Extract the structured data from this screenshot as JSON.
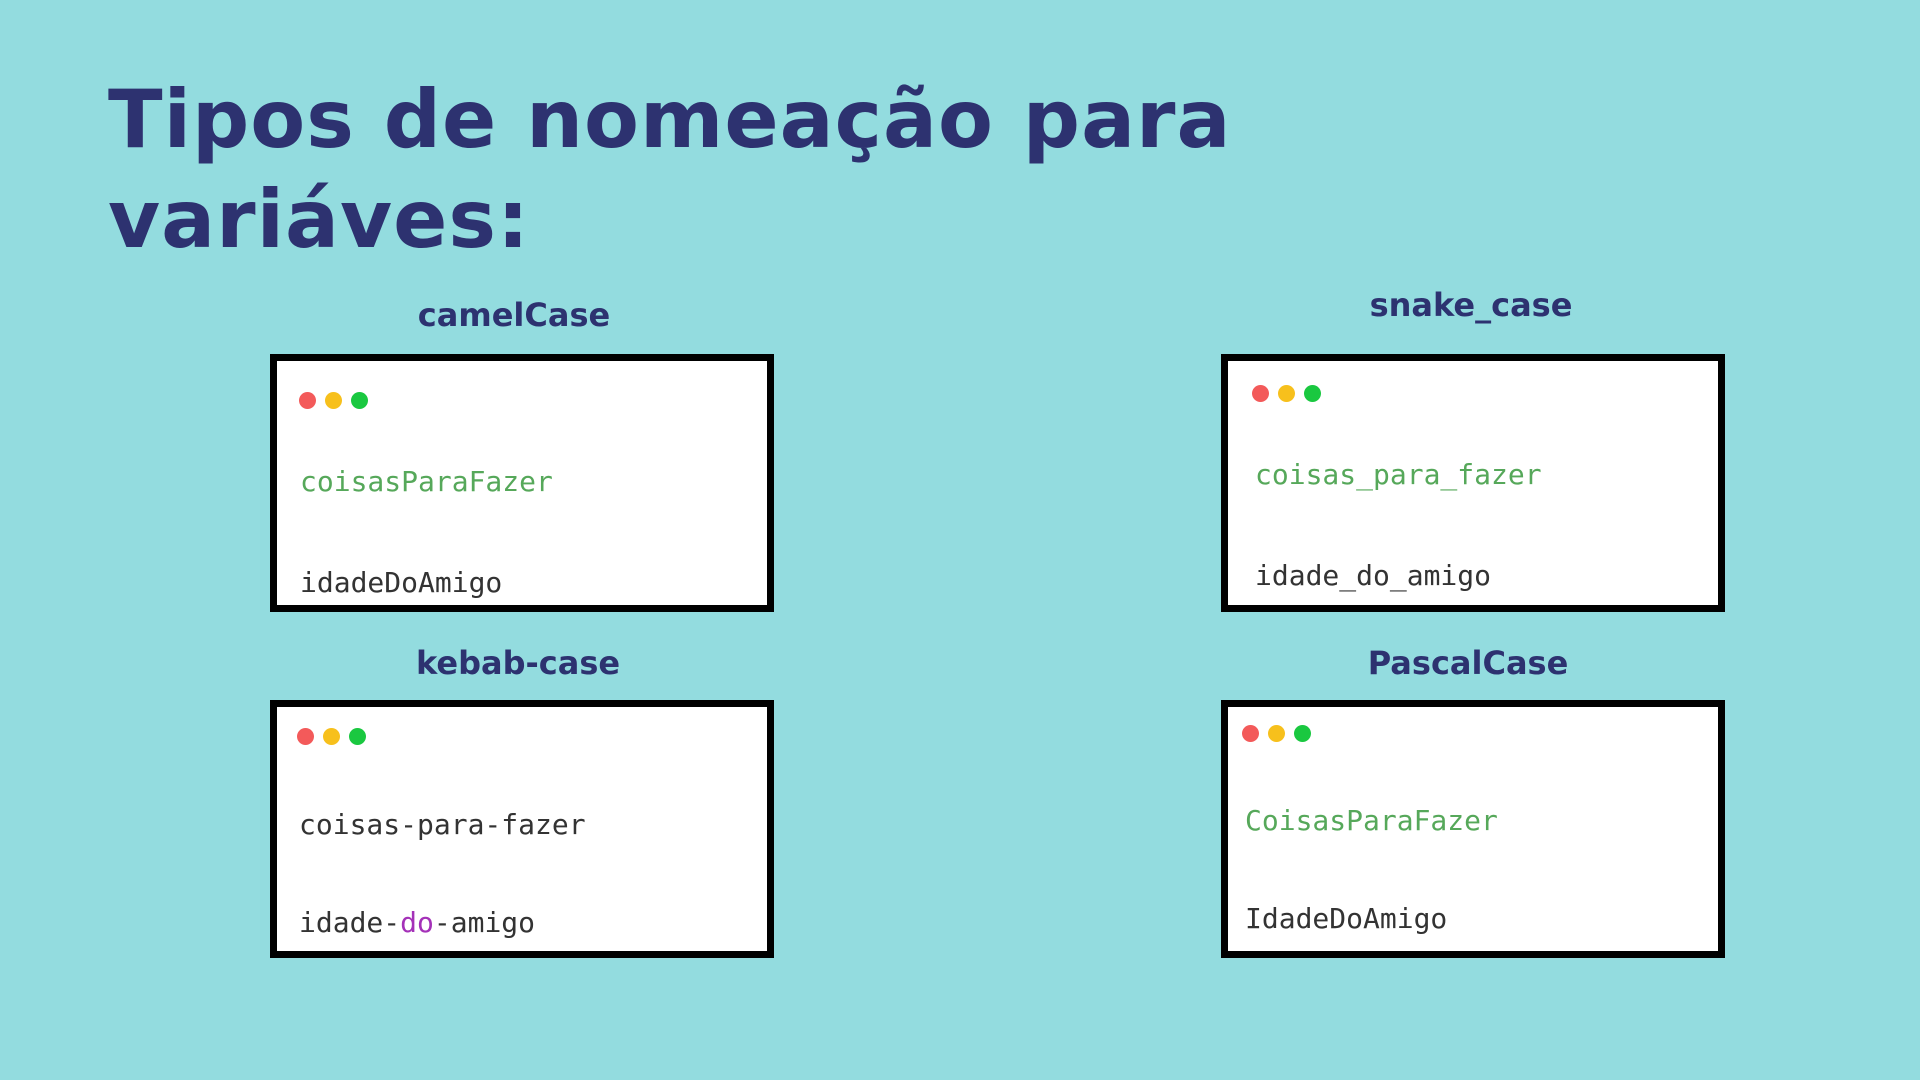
{
  "title": "Tipos de nomeação para variáves:",
  "colors": {
    "background": "#93dcdf",
    "title": "#2d3270",
    "string_green": "#56a85a",
    "keyword_purple": "#a431b8",
    "plain_text": "#333333",
    "dot_red": "#f35a5a",
    "dot_yellow": "#f7c01c",
    "dot_green": "#1ac840"
  },
  "cards": [
    {
      "label": "camelCase",
      "line1": "coisasParaFazer",
      "line2": "idadeDoAmigo"
    },
    {
      "label": "snake_case",
      "line1": "coisas_para_fazer",
      "line2": "idade_do_amigo"
    },
    {
      "label": "kebab-case",
      "line1": "coisas-para-fazer",
      "line2_prefix": "idade-",
      "line2_keyword": "do",
      "line2_suffix": "-amigo"
    },
    {
      "label": "PascalCase",
      "line1": "CoisasParaFazer",
      "line2": "IdadeDoAmigo"
    }
  ]
}
